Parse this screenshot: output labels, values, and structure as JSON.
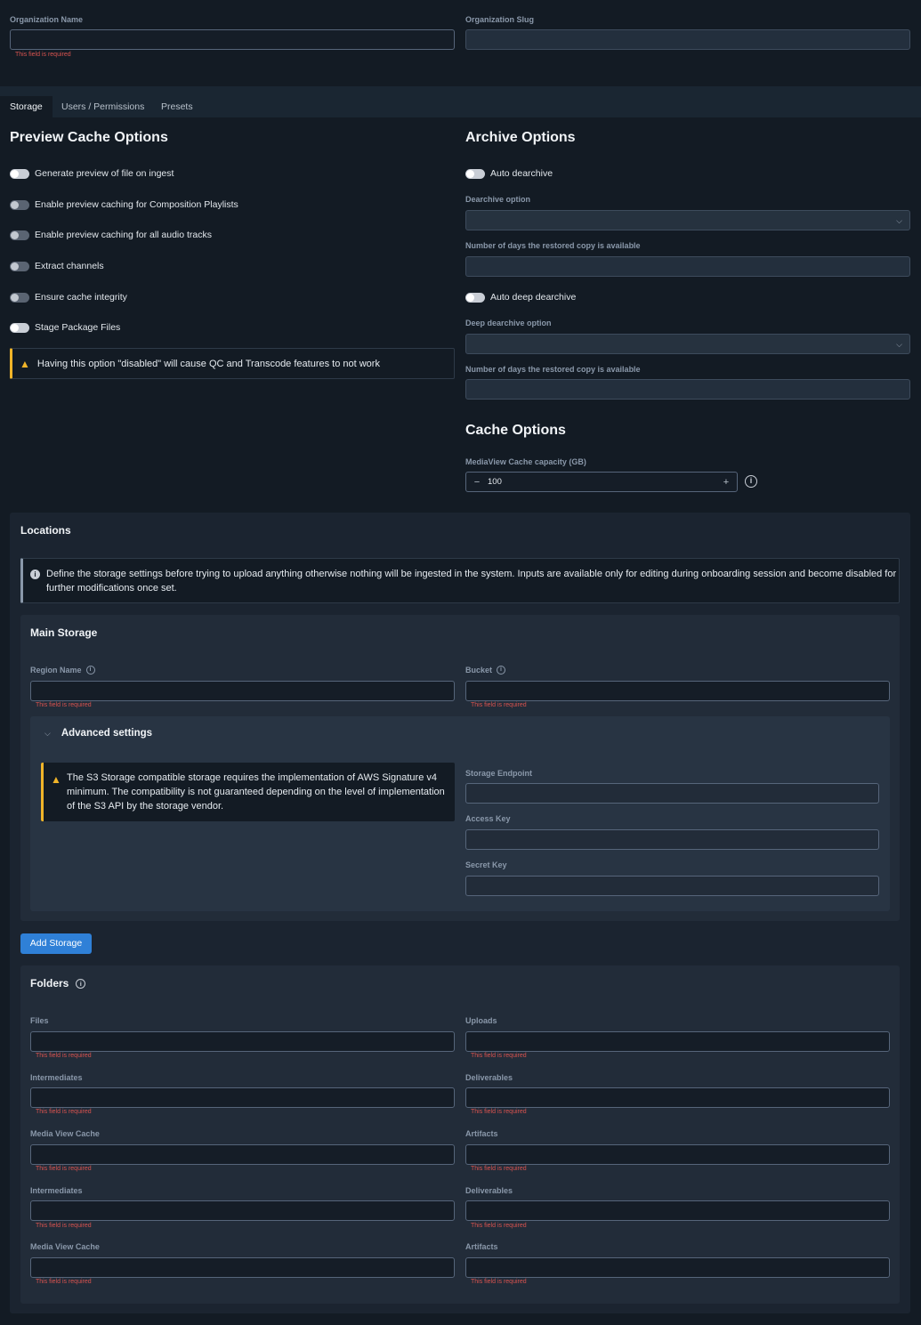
{
  "org": {
    "name_label": "Organization Name",
    "name_value": "",
    "name_error": "This field is required",
    "slug_label": "Organization Slug",
    "slug_value": ""
  },
  "tabs": [
    {
      "label": "Storage",
      "active": true
    },
    {
      "label": "Users / Permissions",
      "active": false
    },
    {
      "label": "Presets",
      "active": false
    }
  ],
  "preview": {
    "title": "Preview Cache Options",
    "toggles": [
      {
        "label": "Generate preview of file on ingest",
        "on": true
      },
      {
        "label": "Enable preview caching for Composition Playlists",
        "on": false
      },
      {
        "label": "Enable preview caching for all audio tracks",
        "on": false
      },
      {
        "label": "Extract channels",
        "on": false
      },
      {
        "label": "Ensure cache integrity",
        "on": false
      },
      {
        "label": "Stage Package Files",
        "on": true
      }
    ],
    "warning": "Having this option \"disabled\" will cause QC and Transcode features to not work"
  },
  "archive": {
    "title": "Archive Options",
    "auto_dearchive": "Auto dearchive",
    "dearchive_option_label": "Dearchive option",
    "days_label_1": "Number of days the restored copy is available",
    "auto_deep_dearchive": "Auto deep dearchive",
    "deep_dearchive_option_label": "Deep dearchive option",
    "days_label_2": "Number of days the restored copy is available"
  },
  "cache": {
    "title": "Cache Options",
    "capacity_label": "MediaView Cache capacity (GB)",
    "capacity_value": "100",
    "minus": "−",
    "plus": "+"
  },
  "locations": {
    "title": "Locations",
    "info": "Define the storage settings before trying to upload anything otherwise nothing will be ingested in the system. Inputs are available only for editing during onboarding session and become disabled for further modifications once set."
  },
  "main_storage": {
    "title": "Main Storage",
    "region_label": "Region Name",
    "bucket_label": "Bucket",
    "error": "This field is required",
    "advanced_title": "Advanced settings",
    "s3_warning": "The S3 Storage compatible storage requires the implementation of AWS Signature v4 minimum. The compatibility is not guaranteed depending on the level of implementation of the S3 API by the storage vendor.",
    "endpoint_label": "Storage Endpoint",
    "access_key_label": "Access Key",
    "secret_key_label": "Secret Key"
  },
  "add_storage_label": "Add Storage",
  "folders": {
    "title": "Folders",
    "error": "This field is required",
    "rows": [
      {
        "left": "Files",
        "right": "Uploads"
      },
      {
        "left": "Intermediates",
        "right": "Deliverables"
      },
      {
        "left": "Media View Cache",
        "right": "Artifacts"
      },
      {
        "left": "Intermediates",
        "right": "Deliverables"
      },
      {
        "left": "Media View Cache",
        "right": "Artifacts"
      }
    ]
  },
  "colors": {
    "background": "#131b24",
    "error": "#d9534f",
    "warning": "#f0b429",
    "primary_button": "#2f80d7"
  }
}
